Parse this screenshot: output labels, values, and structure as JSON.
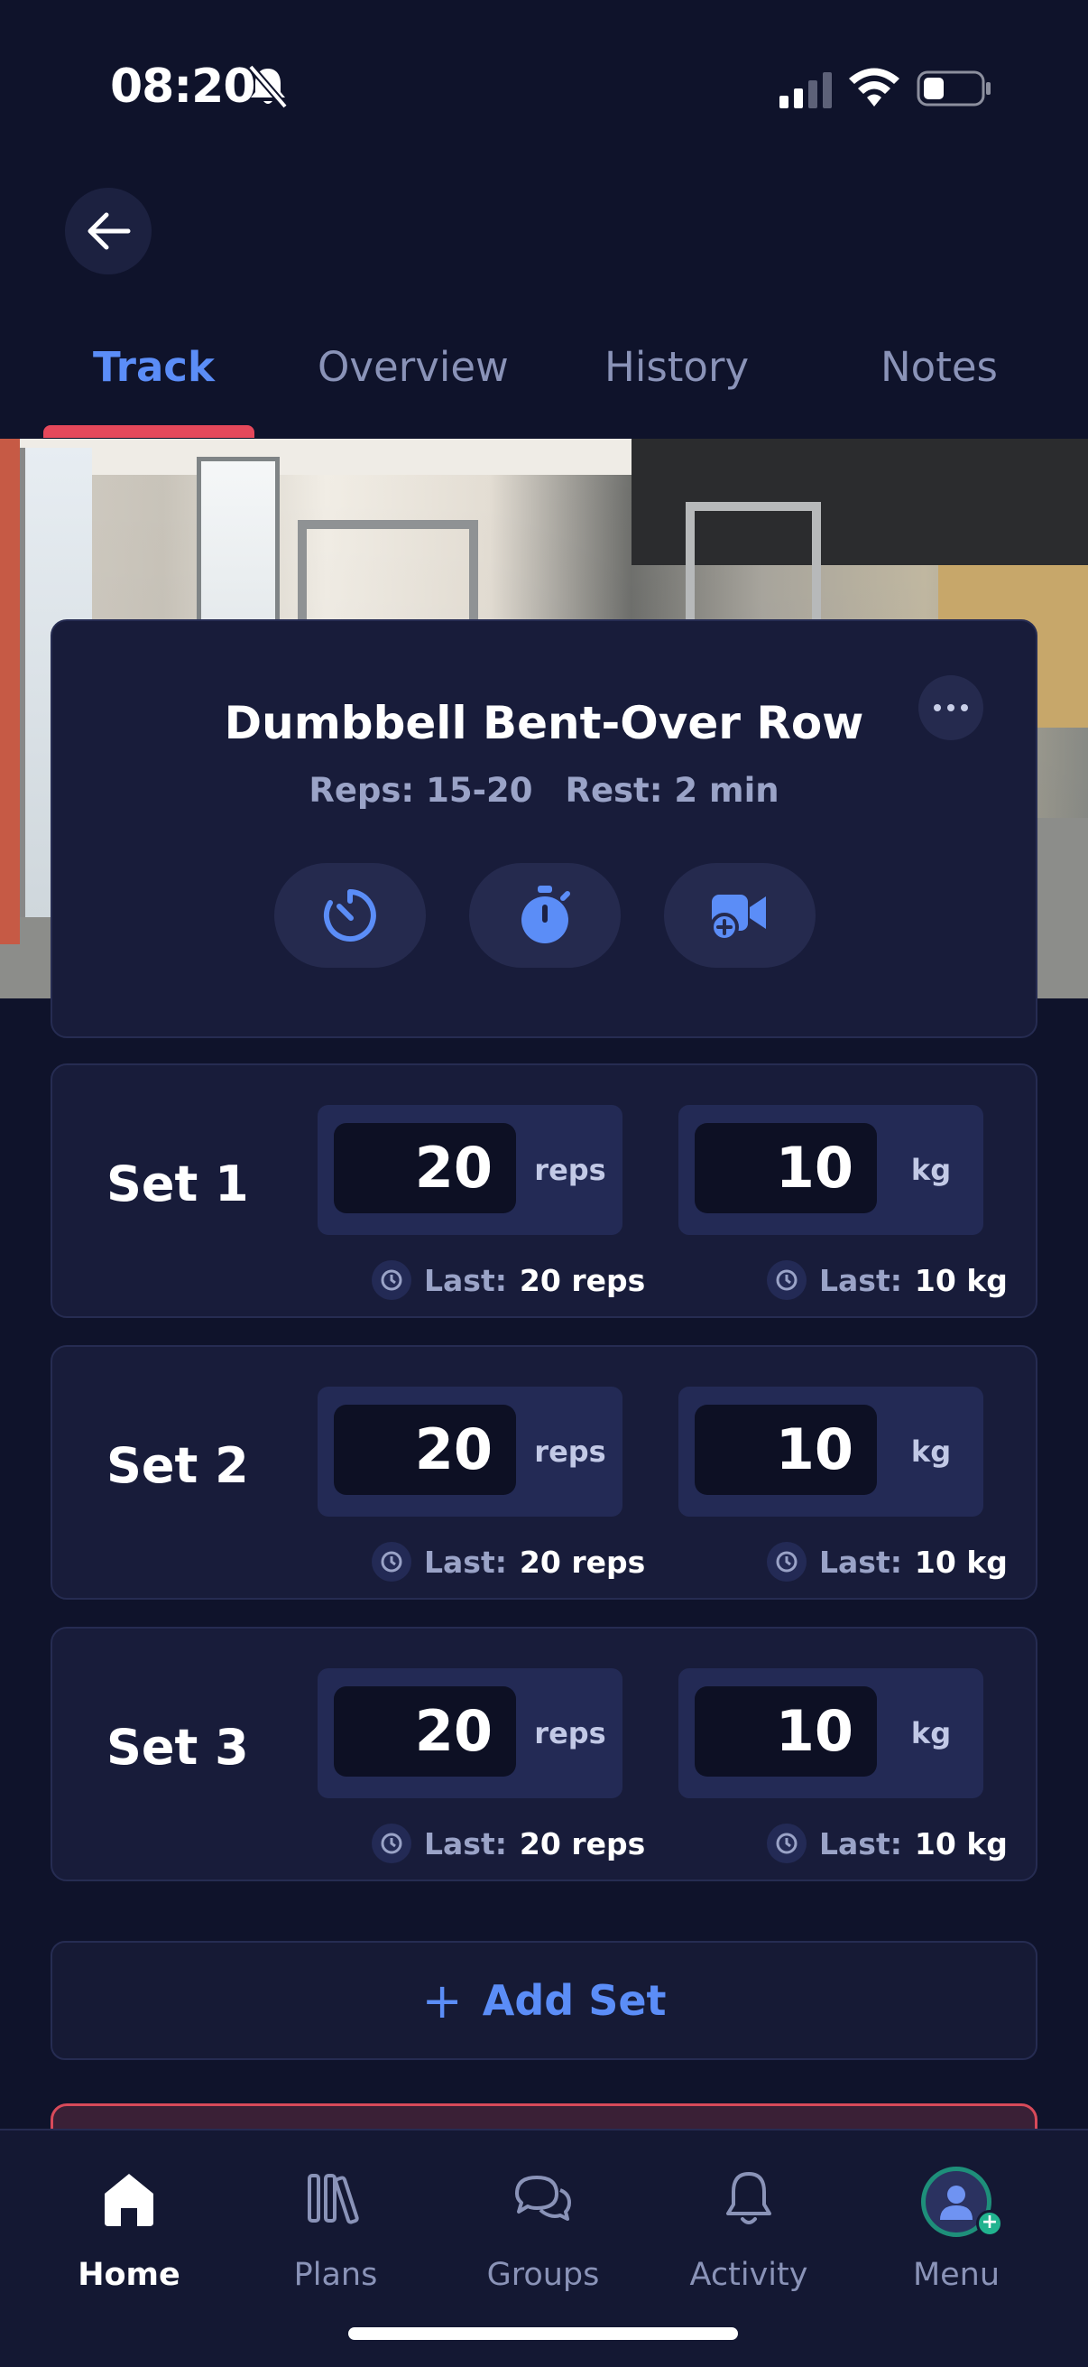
{
  "status_bar": {
    "time": "08:20"
  },
  "tabs": [
    {
      "label": "Track",
      "active": true
    },
    {
      "label": "Overview",
      "active": false
    },
    {
      "label": "History",
      "active": false
    },
    {
      "label": "Notes",
      "active": false
    }
  ],
  "exercise": {
    "title": "Dumbbell Bent-Over Row",
    "reps": "Reps: 15-20",
    "rest": "Rest: 2 min",
    "actions": [
      "rest-timer-icon",
      "stopwatch-icon",
      "add-video-icon"
    ]
  },
  "sets": [
    {
      "label": "Set 1",
      "reps": "20",
      "reps_unit": "reps",
      "weight": "10",
      "weight_unit": "kg",
      "last_prefix": "Last:",
      "last_reps": "20 reps",
      "last_weight": "10 kg"
    },
    {
      "label": "Set 2",
      "reps": "20",
      "reps_unit": "reps",
      "weight": "10",
      "weight_unit": "kg",
      "last_prefix": "Last:",
      "last_reps": "20 reps",
      "last_weight": "10 kg"
    },
    {
      "label": "Set 3",
      "reps": "20",
      "reps_unit": "reps",
      "weight": "10",
      "weight_unit": "kg",
      "last_prefix": "Last:",
      "last_reps": "20 reps",
      "last_weight": "10 kg"
    }
  ],
  "add_set": {
    "icon": "+",
    "label": "Add Set"
  },
  "bottom_nav": [
    {
      "label": "Home",
      "icon": "home-icon",
      "active": true
    },
    {
      "label": "Plans",
      "icon": "plans-icon",
      "active": false
    },
    {
      "label": "Groups",
      "icon": "groups-icon",
      "active": false
    },
    {
      "label": "Activity",
      "icon": "bell-icon",
      "active": false
    },
    {
      "label": "Menu",
      "icon": "avatar-icon",
      "active": false
    }
  ],
  "colors": {
    "background": "#0f132b",
    "accent": "#5b8df7",
    "tab_indicator": "#e5485b",
    "card": "#181c3a"
  }
}
